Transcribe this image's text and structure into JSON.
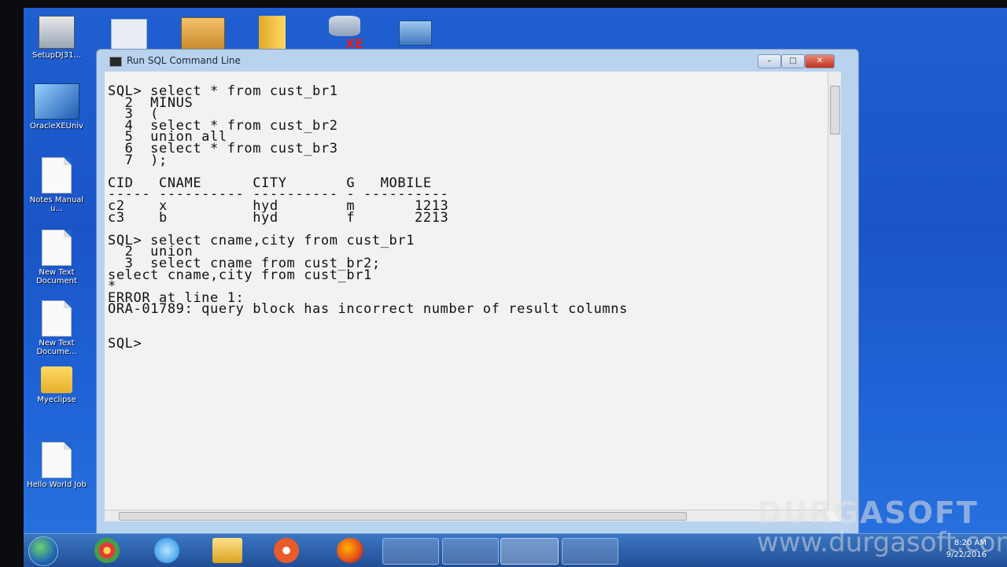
{
  "window": {
    "title": "Run SQL Command Line",
    "minimize": "–",
    "maximize": "□",
    "close": "✕"
  },
  "console": {
    "lines": [
      "SQL> select * from cust_br1",
      "  2  MINUS",
      "  3  (",
      "  4  select * from cust_br2",
      "  5  union all",
      "  6  select * from cust_br3",
      "  7  );",
      "",
      "CID   CNAME      CITY       G   MOBILE",
      "----- ---------- ---------- - ----------",
      "c2    x          hyd        m       1213",
      "c3    b          hyd        f       2213",
      "",
      "SQL> select cname,city from cust_br1",
      "  2  union",
      "  3  select cname from cust_br2;",
      "select cname,city from cust_br1",
      "*",
      "ERROR at line 1:",
      "ORA-01789: query block has incorrect number of result columns",
      "",
      "",
      "SQL> "
    ]
  },
  "desktop_icons": [
    {
      "label": "SetupDJ31...",
      "icon": "setup-icon"
    },
    {
      "label": "OracleXEUniv",
      "icon": "oracle-installer-icon"
    },
    {
      "label": "Notes Manual u...",
      "icon": "document-icon"
    },
    {
      "label": "New Text Document",
      "icon": "text-document-icon"
    },
    {
      "label": "New Text Docume...",
      "icon": "text-document-icon"
    },
    {
      "label": "Myeclipse",
      "icon": "folder-icon"
    },
    {
      "label": "Hello World Job",
      "icon": "text-document-icon"
    }
  ],
  "top_icons": [
    "document-icon",
    "tomcat-icon",
    "folder-icon",
    "oracle-xe-icon",
    "network-shortcut-icon"
  ],
  "taskbar": {
    "apps": [
      "chrome-icon",
      "internet-explorer-icon",
      "file-explorer-icon",
      "media-player-icon",
      "firefox-icon",
      "validator-icon",
      "paint-icon",
      "sql-command-line-icon",
      "network-icon"
    ],
    "clock_time": "8:20 AM",
    "clock_date": "9/22/2016"
  },
  "watermark": {
    "brand": "DURGASOFT",
    "url": "www.durgasoft.com"
  }
}
